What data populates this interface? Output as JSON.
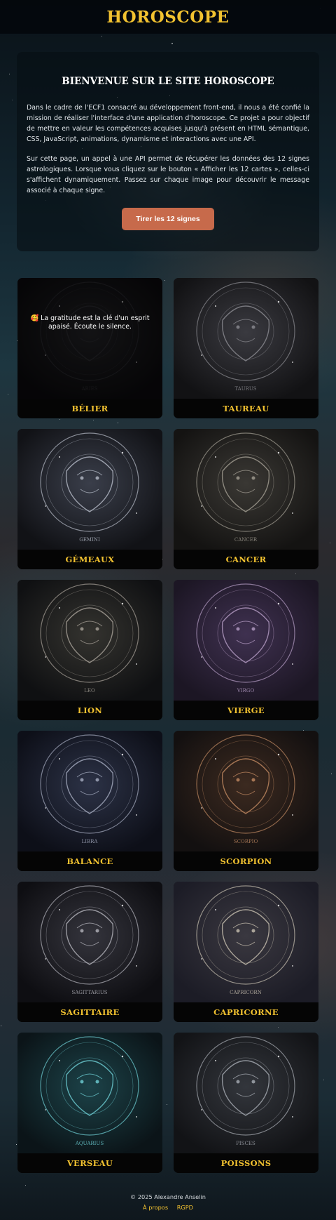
{
  "header": {
    "title": "HOROSCOPE"
  },
  "intro": {
    "heading": "BIENVENUE SUR LE SITE HOROSCOPE",
    "paragraph1": "Dans le cadre de l'ECF1 consacré au développement front-end, il nous a été confié la mission de réaliser l'interface d'une application d'horoscope. Ce projet a pour objectif de mettre en valeur les compétences acquises jusqu'à présent en HTML sémantique, CSS, JavaScript, animations, dynamisme et interactions avec une API.",
    "paragraph2": "Sur cette page, un appel à une API permet de récupérer les données des 12 signes astrologiques. Lorsque vous cliquez sur le bouton « Afficher les 12 cartes », celles-ci s'affichent dynamiquement. Passez sur chaque image pour découvrir le message associé à chaque signe.",
    "button_label": "Tirer les 12 signes"
  },
  "signs": [
    {
      "name": "BÉLIER",
      "latin": "ARIES",
      "icon": "ram-head-icon",
      "message": "🥰 La gratitude est la clé d'un esprit apaisé. Écoute le silence.",
      "palette": {
        "bg": "#0e0d10",
        "line": "#3a3a40",
        "glow": "#2a2a2e"
      }
    },
    {
      "name": "TAUREAU",
      "latin": "TAURUS",
      "icon": "bull-head-icon",
      "palette": {
        "bg": "#121214",
        "line": "#8c8c92",
        "glow": "#3a3a40"
      }
    },
    {
      "name": "GÉMEAUX",
      "latin": "GEMINI",
      "icon": "twins-icon",
      "palette": {
        "bg": "#111216",
        "line": "#b6bcc8",
        "glow": "#3a3e4a"
      }
    },
    {
      "name": "CANCER",
      "latin": "CANCER",
      "icon": "crab-icon",
      "palette": {
        "bg": "#141312",
        "line": "#a49f94",
        "glow": "#3a3834"
      }
    },
    {
      "name": "LION",
      "latin": "LEO",
      "icon": "lion-head-icon",
      "palette": {
        "bg": "#0f1012",
        "line": "#a9a39a",
        "glow": "#34332f"
      }
    },
    {
      "name": "VIERGE",
      "latin": "VIRGO",
      "icon": "maiden-icon",
      "palette": {
        "bg": "#1c1624",
        "line": "#b79ec6",
        "glow": "#3f3150"
      }
    },
    {
      "name": "BALANCE",
      "latin": "LIBRA",
      "icon": "scales-icon",
      "palette": {
        "bg": "#0d0f18",
        "line": "#a6acc0",
        "glow": "#2c3246"
      }
    },
    {
      "name": "SCORPION",
      "latin": "SCORPIO",
      "icon": "scorpion-icon",
      "palette": {
        "bg": "#131010",
        "line": "#c28a62",
        "glow": "#3c2a20"
      }
    },
    {
      "name": "SAGITTAIRE",
      "latin": "SAGITTARIUS",
      "icon": "archer-icon",
      "palette": {
        "bg": "#0e0e12",
        "line": "#b4b4bc",
        "glow": "#34343c"
      }
    },
    {
      "name": "CAPRICORNE",
      "latin": "CAPRICORN",
      "icon": "goat-icon",
      "palette": {
        "bg": "#1c1c26",
        "line": "#c8c0b0",
        "glow": "#3a3840"
      }
    },
    {
      "name": "VERSEAU",
      "latin": "AQUARIUS",
      "icon": "water-bearer-icon",
      "palette": {
        "bg": "#0b1418",
        "line": "#6fd0d6",
        "glow": "#1c4248"
      }
    },
    {
      "name": "POISSONS",
      "latin": "PISCES",
      "icon": "fish-icon",
      "palette": {
        "bg": "#121316",
        "line": "#a8acb4",
        "glow": "#33363c"
      }
    }
  ],
  "footer": {
    "copyright": "© 2025 Alexandre Anselin",
    "links": [
      "À propos",
      "RGPD"
    ]
  }
}
